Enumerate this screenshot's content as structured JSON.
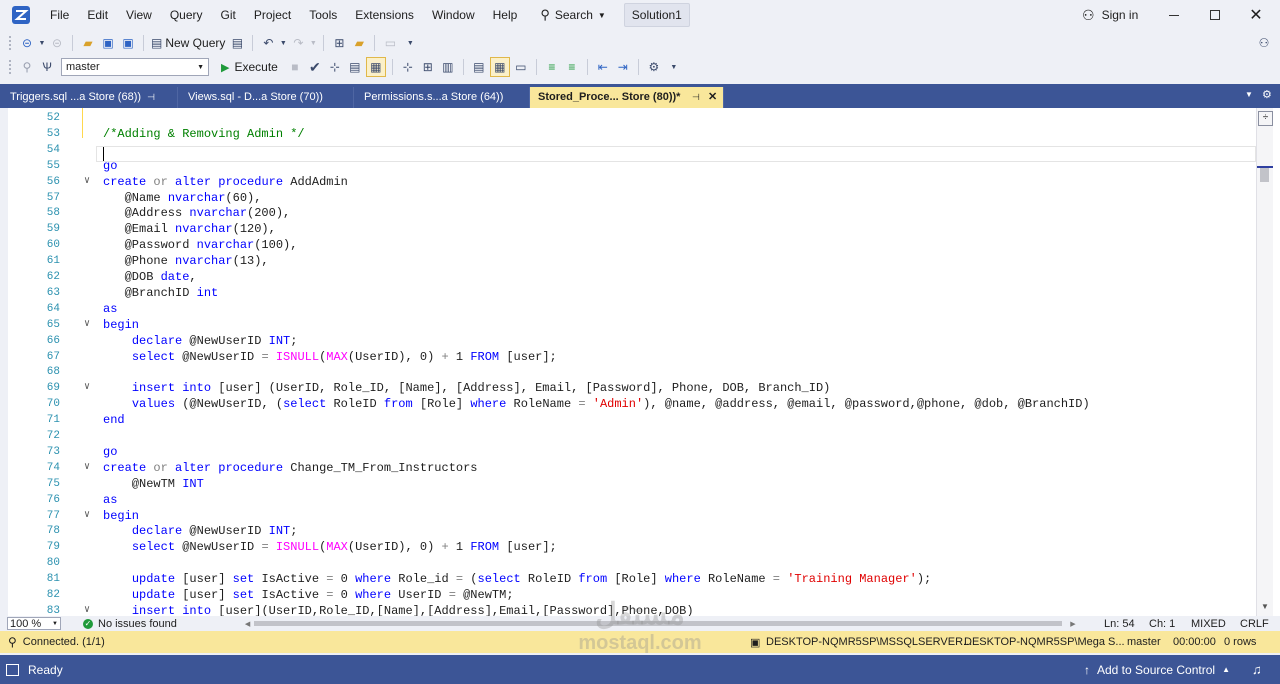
{
  "menu": {
    "items": [
      "File",
      "Edit",
      "View",
      "Query",
      "Git",
      "Project",
      "Tools",
      "Extensions",
      "Window",
      "Help"
    ],
    "search_label": "Search",
    "solution_name": "Solution1",
    "sign_in": "Sign in"
  },
  "toolbar": {
    "new_query_label": "New Query",
    "database_selected": "master",
    "execute_label": "Execute"
  },
  "tabs": [
    {
      "label": "Triggers.sql ...a Store (68))",
      "active": false
    },
    {
      "label": "Views.sql - D...a Store (70))",
      "active": false
    },
    {
      "label": "Permissions.s...a Store (64))",
      "active": false
    },
    {
      "label": "Stored_Proce... Store (80))*",
      "active": true
    }
  ],
  "editor": {
    "lines": [
      {
        "n": "52",
        "text": ""
      },
      {
        "n": "53",
        "text": "/*Adding & Removing Admin */"
      },
      {
        "n": "54",
        "text": ""
      },
      {
        "n": "55",
        "text": "go"
      },
      {
        "n": "56",
        "text": "create or alter procedure AddAdmin",
        "fold": true
      },
      {
        "n": "57",
        "text": "   @Name nvarchar(60),"
      },
      {
        "n": "58",
        "text": "   @Address nvarchar(200),"
      },
      {
        "n": "59",
        "text": "   @Email nvarchar(120),"
      },
      {
        "n": "60",
        "text": "   @Password nvarchar(100),"
      },
      {
        "n": "61",
        "text": "   @Phone nvarchar(13),"
      },
      {
        "n": "62",
        "text": "   @DOB date,"
      },
      {
        "n": "63",
        "text": "   @BranchID int"
      },
      {
        "n": "64",
        "text": "as"
      },
      {
        "n": "65",
        "text": "begin",
        "fold": true
      },
      {
        "n": "66",
        "text": "    declare @NewUserID INT;"
      },
      {
        "n": "67",
        "text": "    select @NewUserID = ISNULL(MAX(UserID), 0) + 1 FROM [user];"
      },
      {
        "n": "68",
        "text": ""
      },
      {
        "n": "69",
        "text": "    insert into [user] (UserID, Role_ID, [Name], [Address], Email, [Password], Phone, DOB, Branch_ID)",
        "fold": true
      },
      {
        "n": "70",
        "text": "    values (@NewUserID, (select RoleID from [Role] where RoleName = 'Admin'), @name, @address, @email, @password,@phone, @dob, @BranchID)"
      },
      {
        "n": "71",
        "text": "end"
      },
      {
        "n": "72",
        "text": ""
      },
      {
        "n": "73",
        "text": "go"
      },
      {
        "n": "74",
        "text": "create or alter procedure Change_TM_From_Instructors",
        "fold": true
      },
      {
        "n": "75",
        "text": "    @NewTM INT"
      },
      {
        "n": "76",
        "text": "as"
      },
      {
        "n": "77",
        "text": "begin",
        "fold": true
      },
      {
        "n": "78",
        "text": "    declare @NewUserID INT;"
      },
      {
        "n": "79",
        "text": "    select @NewUserID = ISNULL(MAX(UserID), 0) + 1 FROM [user];"
      },
      {
        "n": "80",
        "text": ""
      },
      {
        "n": "81",
        "text": "    update [user] set IsActive = 0 where Role_id = (select RoleID from [Role] where RoleName = 'Training Manager');"
      },
      {
        "n": "82",
        "text": "    update [user] set IsActive = 0 where UserID = @NewTM;"
      },
      {
        "n": "83",
        "text": "    insert into [user](UserID,Role_ID,[Name],[Address],Email,[Password],Phone,DOB)",
        "fold": true
      }
    ]
  },
  "editor_status": {
    "zoom": "100 %",
    "issues": "No issues found",
    "line": "Ln: 54",
    "col": "Ch: 1",
    "mode": "MIXED",
    "eol": "CRLF"
  },
  "connection": {
    "status": "Connected. (1/1)",
    "server": "DESKTOP-NQMR5SP\\MSSQLSERVER...",
    "user": "DESKTOP-NQMR5SP\\Mega S...",
    "database": "master",
    "elapsed": "00:00:00",
    "rows": "0 rows"
  },
  "statusbar": {
    "ready": "Ready",
    "source_control": "Add to Source Control"
  },
  "watermark": {
    "arabic": "مستقل",
    "site": "mostaql.com"
  },
  "colors": {
    "accent": "#3c5596",
    "active_tab": "#f9e79b",
    "keyword": "#0000ff",
    "function": "#ff00ff",
    "string": "#e00000",
    "comment": "#008000",
    "line_number": "#2b91af"
  }
}
